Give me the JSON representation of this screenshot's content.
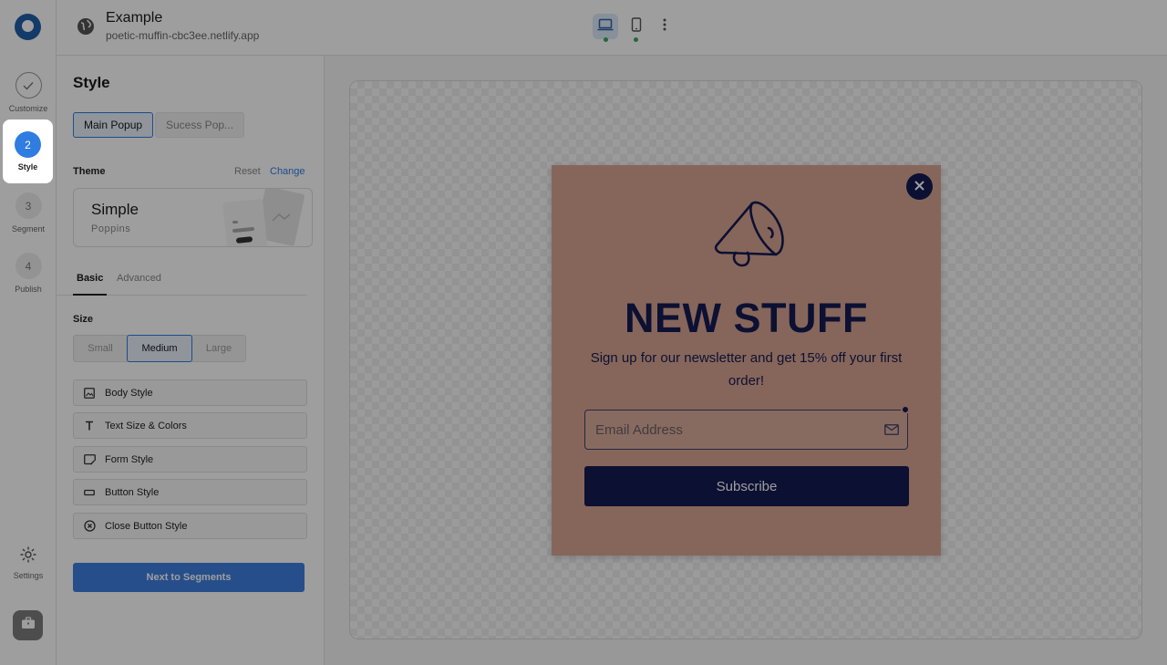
{
  "topbar": {
    "site_title": "Example",
    "site_url": "poetic-muffin-cbc3ee.netlify.app"
  },
  "rail": {
    "steps": [
      {
        "number": "",
        "label": "Customize",
        "state": "done"
      },
      {
        "number": "2",
        "label": "Style",
        "state": "active"
      },
      {
        "number": "3",
        "label": "Segment",
        "state": "upcoming"
      },
      {
        "number": "4",
        "label": "Publish",
        "state": "upcoming"
      }
    ],
    "settings_label": "Settings"
  },
  "panel": {
    "title": "Style",
    "popup_tabs": [
      "Main Popup",
      "Sucess Pop..."
    ],
    "theme": {
      "label": "Theme",
      "reset": "Reset",
      "change": "Change",
      "name": "Simple",
      "font": "Poppins"
    },
    "style_tabs": [
      "Basic",
      "Advanced"
    ],
    "size": {
      "label": "Size",
      "options": [
        "Small",
        "Medium",
        "Large"
      ],
      "selected": "Medium"
    },
    "options": [
      {
        "label": "Body Style",
        "icon": "image-icon"
      },
      {
        "label": "Text Size & Colors",
        "icon": "text-icon"
      },
      {
        "label": "Form Style",
        "icon": "form-icon"
      },
      {
        "label": "Button Style",
        "icon": "button-icon"
      },
      {
        "label": "Close Button Style",
        "icon": "close-circle-icon"
      }
    ],
    "next_button": "Next to Segments"
  },
  "popup": {
    "heading": "NEW STUFF",
    "text": "Sign up for our newsletter and get 15% off your first order!",
    "email_placeholder": "Email Address",
    "button": "Subscribe",
    "background_color": "#d9a593",
    "accent_color": "#141a52"
  },
  "colors": {
    "primary": "#2f7de1",
    "status_dot": "#3aa55d"
  }
}
